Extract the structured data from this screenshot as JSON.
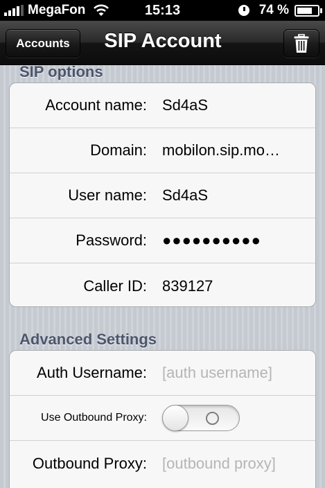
{
  "status_bar": {
    "carrier": "MegaFon",
    "time": "15:13",
    "battery_percent_label": "74 %",
    "battery_level": 0.74,
    "signal_bars": 4,
    "icons": [
      "signal-bars-icon",
      "wifi-icon",
      "alarm-icon",
      "battery-icon"
    ]
  },
  "nav": {
    "back_label": "Accounts",
    "title": "SIP Account",
    "right_icon": "trash-icon"
  },
  "sip_options": {
    "header": "SIP options",
    "rows": [
      {
        "label": "Account name:",
        "value": "Sd4aS"
      },
      {
        "label": "Domain:",
        "value": "mobilon.sip.mo…"
      },
      {
        "label": "User name:",
        "value": "Sd4aS"
      },
      {
        "label": "Password:",
        "value": "●●●●●●●●●●"
      },
      {
        "label": "Caller ID:",
        "value": "839127"
      }
    ]
  },
  "advanced": {
    "header": "Advanced Settings",
    "auth_username": {
      "label": "Auth Username:",
      "placeholder": "[auth username]"
    },
    "use_outbound_proxy": {
      "label": "Use Outbound Proxy:",
      "on": false
    },
    "outbound_proxy": {
      "label": "Outbound Proxy:",
      "placeholder": "[outbound proxy]"
    }
  },
  "colors": {
    "section_header": "#4c566c",
    "placeholder": "#b5b5b5",
    "navbar": "#1a1a1a"
  }
}
